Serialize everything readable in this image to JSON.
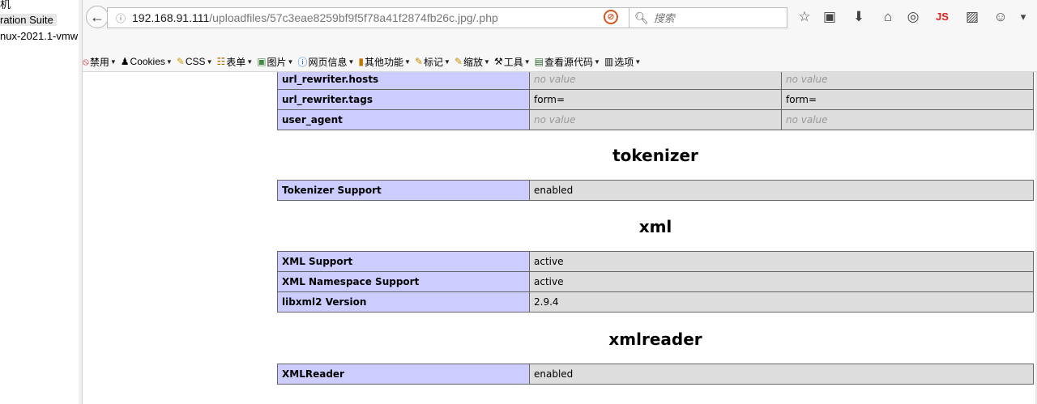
{
  "side_panel": {
    "lines": [
      "机",
      "ration Suite",
      "nux-2021.1-vmw"
    ]
  },
  "browser": {
    "url_host": "192.168.91.111",
    "url_path": "/uploadfiles/57c3eae8259bf9f5f78a41f2874fb26c.jpg/.php",
    "search_placeholder": "搜索",
    "js_label": "JS"
  },
  "menu_bar": {
    "items": [
      {
        "icon": "disable-icon",
        "label": "禁用"
      },
      {
        "icon": "cookie-icon",
        "label": "Cookies"
      },
      {
        "icon": "css-icon",
        "label": "CSS"
      },
      {
        "icon": "form-icon",
        "label": "表单"
      },
      {
        "icon": "image-icon",
        "label": "图片"
      },
      {
        "icon": "info-icon",
        "label": "网页信息"
      },
      {
        "icon": "misc-icon",
        "label": "其他功能"
      },
      {
        "icon": "outline-icon",
        "label": "标记"
      },
      {
        "icon": "resize-icon",
        "label": "缩放"
      },
      {
        "icon": "tools-icon",
        "label": "工具"
      },
      {
        "icon": "view-source-icon",
        "label": "查看源代码"
      },
      {
        "icon": "options-icon",
        "label": "选项"
      }
    ]
  },
  "top_table": {
    "rows": [
      {
        "directive": "url_rewriter.hosts",
        "local": "no value",
        "master": "no value"
      },
      {
        "directive": "url_rewriter.tags",
        "local": "form=",
        "master": "form="
      },
      {
        "directive": "user_agent",
        "local": "no value",
        "master": "no value"
      }
    ]
  },
  "sections": [
    {
      "title": "tokenizer",
      "rows": [
        {
          "name": "Tokenizer Support",
          "value": "enabled"
        }
      ]
    },
    {
      "title": "xml",
      "rows": [
        {
          "name": "XML Support",
          "value": "active"
        },
        {
          "name": "XML Namespace Support",
          "value": "active"
        },
        {
          "name": "libxml2 Version",
          "value": "2.9.4"
        }
      ]
    },
    {
      "title": "xmlreader",
      "rows": [
        {
          "name": "XMLReader",
          "value": "enabled"
        }
      ]
    }
  ],
  "colors": {
    "label_cell": "#ccccff",
    "value_cell": "#dddddd",
    "no_value_text": "#999999"
  }
}
